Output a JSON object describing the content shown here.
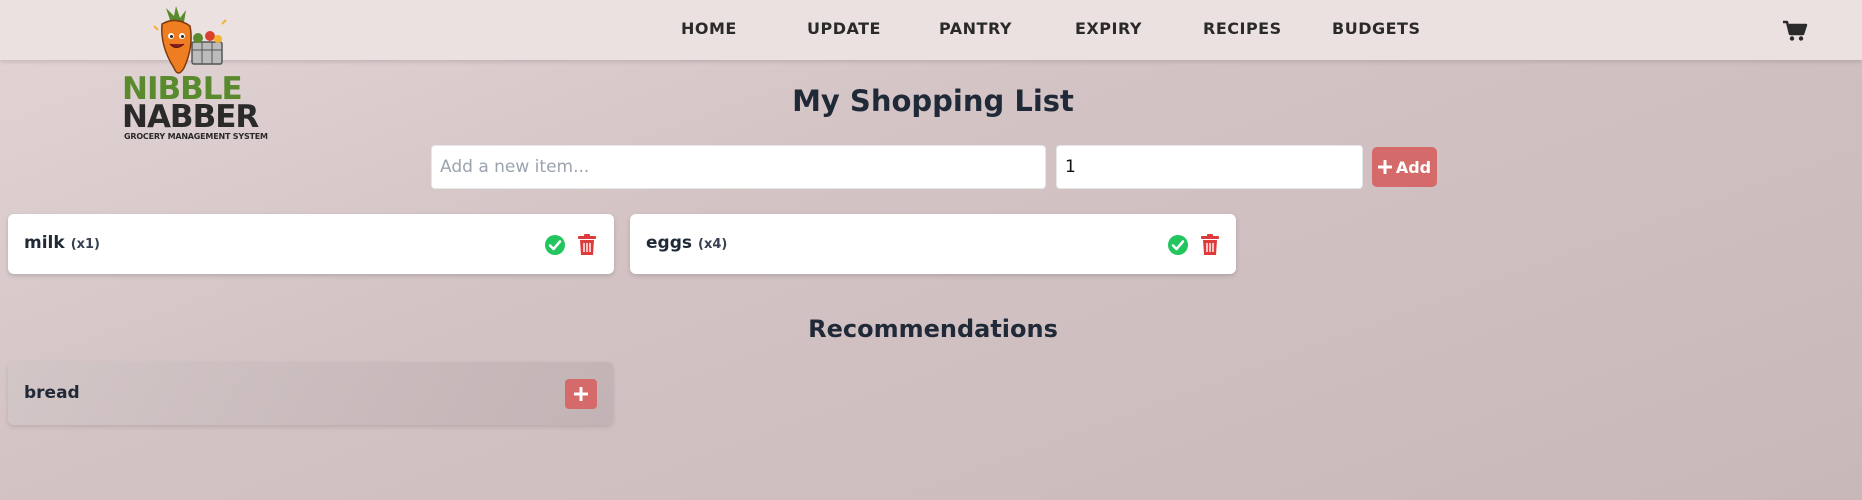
{
  "brand": {
    "logo_line1": "NIBBLE",
    "logo_line2": "NABBER",
    "tagline": "GROCERY MANAGEMENT SYSTEM"
  },
  "nav": {
    "items": [
      {
        "label": "HOME"
      },
      {
        "label": "UPDATE"
      },
      {
        "label": "PANTRY"
      },
      {
        "label": "EXPIRY"
      },
      {
        "label": "RECIPES"
      },
      {
        "label": "BUDGETS"
      }
    ],
    "cart_icon": "shopping-cart-icon"
  },
  "shopping_list": {
    "title": "My Shopping List",
    "item_placeholder": "Add a new item...",
    "quantity_value": "1",
    "add_label": "Add",
    "items": [
      {
        "name": "milk",
        "qty": "(x1)"
      },
      {
        "name": "eggs",
        "qty": "(x4)"
      }
    ]
  },
  "recommendations": {
    "title": "Recommendations",
    "items": [
      {
        "name": "bread"
      }
    ]
  },
  "colors": {
    "accent": "#d46a6a",
    "check": "#22c55e",
    "trash": "#e03b3b",
    "logo_green": "#5a8a2e",
    "logo_dark": "#2a2a2a"
  }
}
